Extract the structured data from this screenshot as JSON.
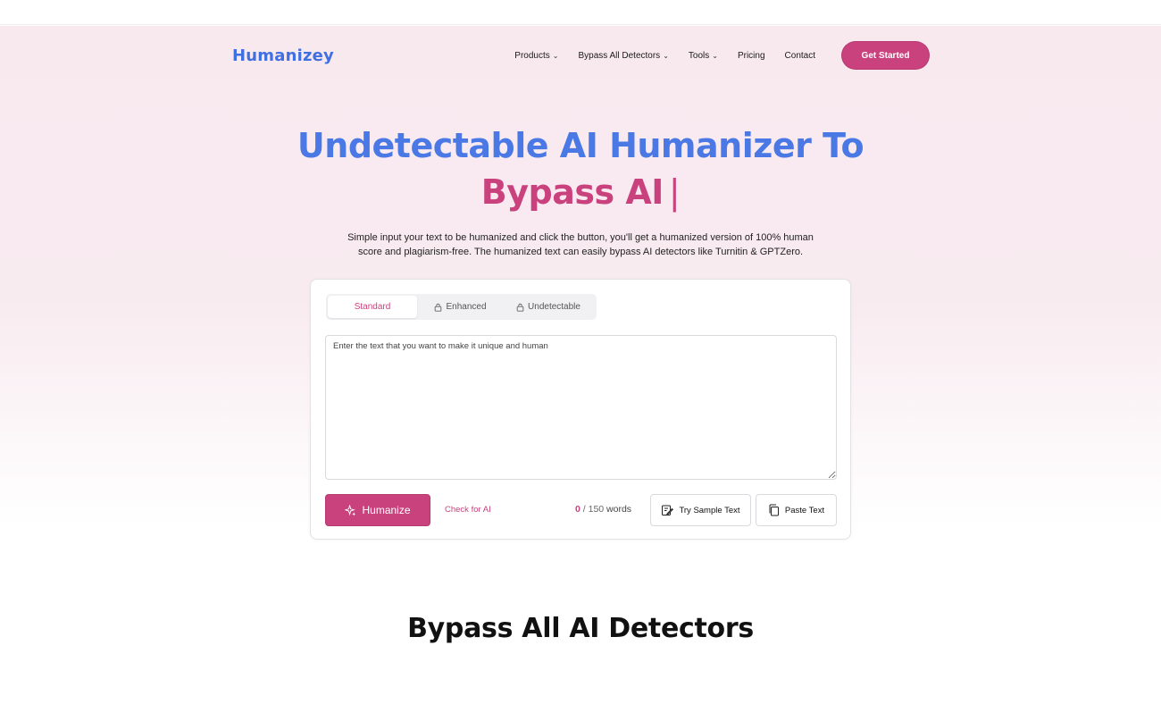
{
  "brand": {
    "logo": "Humanizey",
    "accent": "#c9427d",
    "blue": "#4a79e6"
  },
  "nav": {
    "items": [
      {
        "label": "Products",
        "dropdown": true
      },
      {
        "label": "Bypass All Detectors",
        "dropdown": true
      },
      {
        "label": "Tools",
        "dropdown": true
      },
      {
        "label": "Pricing",
        "dropdown": false
      },
      {
        "label": "Contact",
        "dropdown": false
      }
    ],
    "cta": "Get Started"
  },
  "hero": {
    "title_line1": "Undetectable AI Humanizer To",
    "title_line2": "Bypass AI",
    "cursor": "|",
    "subtitle": "Simple input your text to be humanized and click the button, you'll get a humanized version of 100% human score and plagiarism-free. The humanized text can easily bypass AI detectors like Turnitin & GPTZero."
  },
  "editor": {
    "tabs": [
      {
        "label": "Standard",
        "locked": false,
        "active": true
      },
      {
        "label": "Enhanced",
        "locked": true,
        "active": false
      },
      {
        "label": "Undetectable",
        "locked": true,
        "active": false
      }
    ],
    "placeholder": "Enter the text that you want to make it unique and human",
    "humanize_label": "Humanize",
    "check_label": "Check for AI",
    "word_count": "0",
    "word_limit": "/ 150",
    "word_unit": "words",
    "sample_label": "Try Sample Text",
    "paste_label": "Paste Text"
  },
  "section": {
    "title": "Bypass All AI Detectors"
  }
}
